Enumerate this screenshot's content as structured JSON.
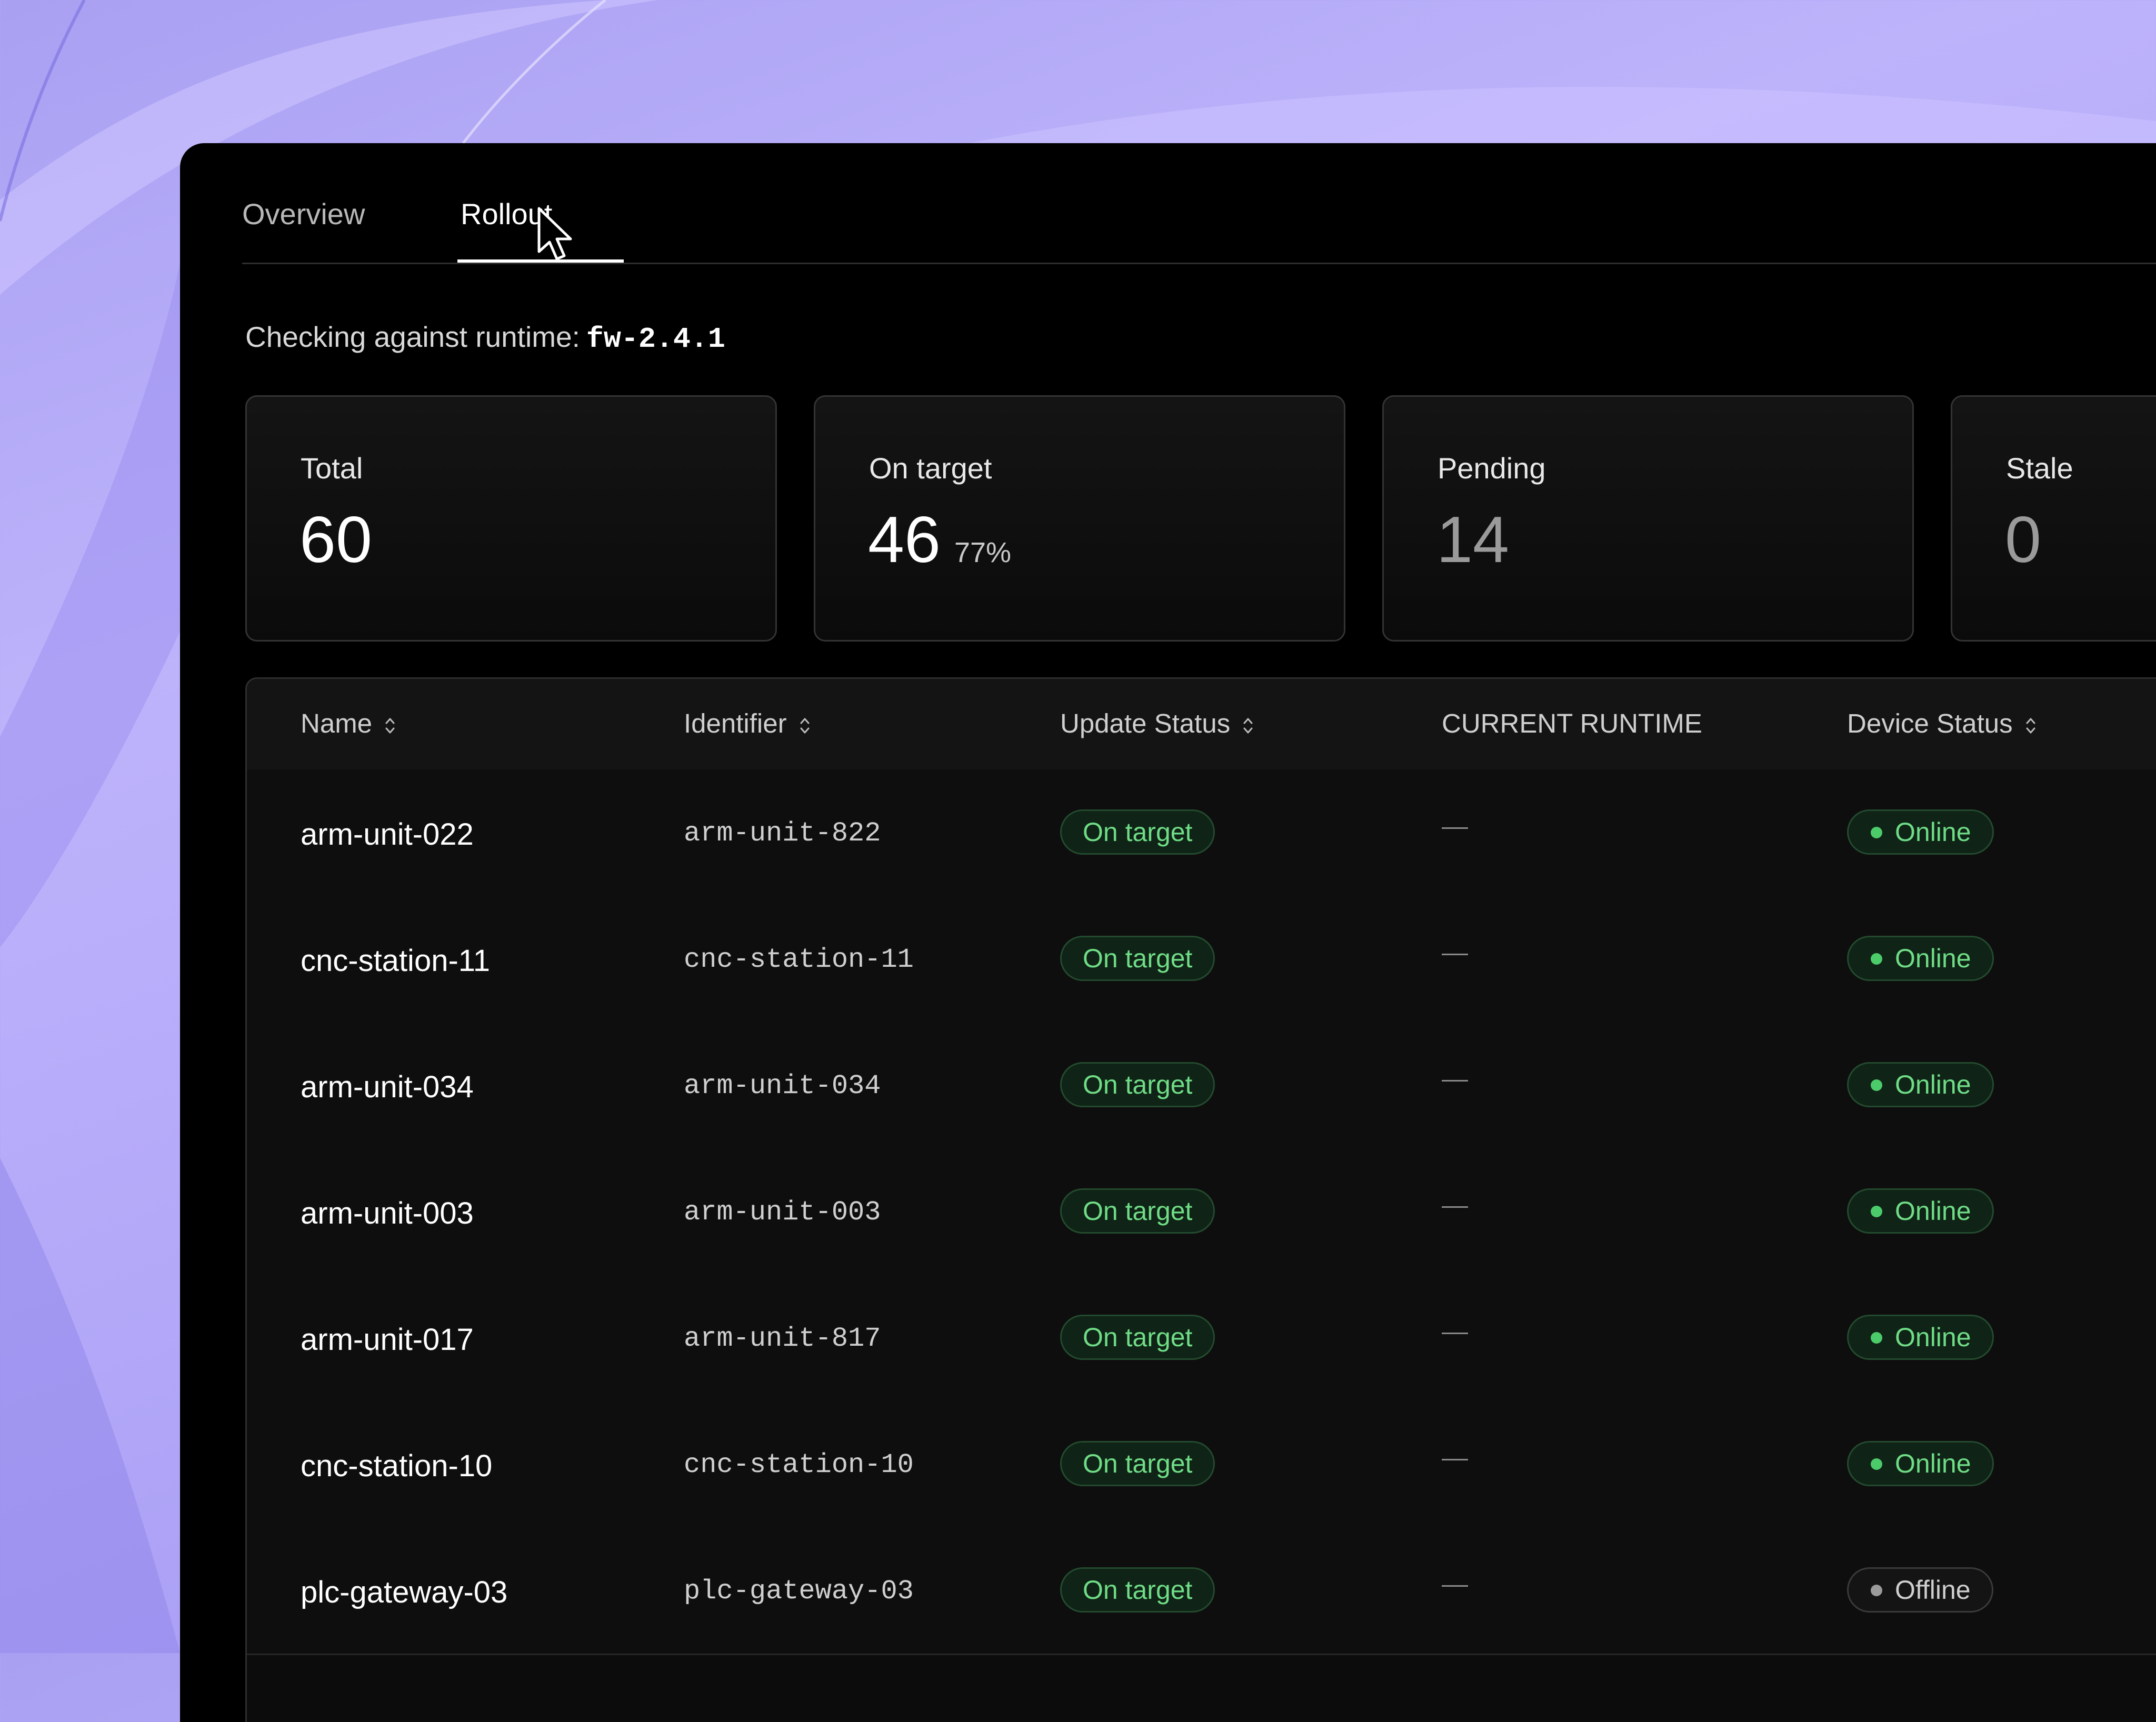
{
  "tabs": [
    {
      "label": "Overview",
      "active": false
    },
    {
      "label": "Rollout",
      "active": true
    }
  ],
  "runtime": {
    "label": "Checking against runtime:",
    "value": "fw-2.4.1"
  },
  "stats": [
    {
      "label": "Total",
      "value": "60"
    },
    {
      "label": "On target",
      "value": "46",
      "percent": "77%"
    },
    {
      "label": "Pending",
      "value": "14"
    },
    {
      "label": "Stale",
      "value": "0"
    }
  ],
  "table": {
    "headers": [
      "Name",
      "Identifier",
      "Update Status",
      "CURRENT RUNTIME",
      "Device Status"
    ],
    "rows": [
      {
        "name": "arm-unit-022",
        "identifier": "arm-unit-822",
        "update_status": "On target",
        "runtime": "—",
        "device_status": "Online"
      },
      {
        "name": "cnc-station-11",
        "identifier": "cnc-station-11",
        "update_status": "On target",
        "runtime": "—",
        "device_status": "Online"
      },
      {
        "name": "arm-unit-034",
        "identifier": "arm-unit-034",
        "update_status": "On target",
        "runtime": "—",
        "device_status": "Online"
      },
      {
        "name": "arm-unit-003",
        "identifier": "arm-unit-003",
        "update_status": "On target",
        "runtime": "—",
        "device_status": "Online"
      },
      {
        "name": "arm-unit-017",
        "identifier": "arm-unit-817",
        "update_status": "On target",
        "runtime": "—",
        "device_status": "Online"
      },
      {
        "name": "cnc-station-10",
        "identifier": "cnc-station-10",
        "update_status": "On target",
        "runtime": "—",
        "device_status": "Online"
      },
      {
        "name": "plc-gateway-03",
        "identifier": "plc-gateway-03",
        "update_status": "On target",
        "runtime": "—",
        "device_status": "Offline"
      }
    ]
  },
  "colors": {
    "accent_green": "#6fdc86",
    "background": "#000000",
    "wallpaper": "#b3a8f8"
  }
}
